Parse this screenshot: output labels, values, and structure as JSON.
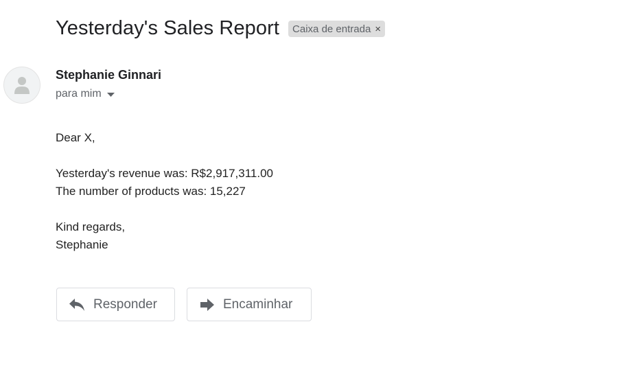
{
  "subject": "Yesterday's Sales Report",
  "label": {
    "text": "Caixa de entrada",
    "remove_glyph": "×"
  },
  "sender": {
    "name": "Stephanie Ginnari",
    "avatar_icon": "person-icon"
  },
  "recipient": {
    "text": "para mim",
    "caret_icon": "caret-down-icon"
  },
  "body": {
    "greeting": "Dear X,",
    "revenue_line": "Yesterday's revenue was: R$2,917,311.00",
    "products_line": "The number of products was: 15,227",
    "closing": "Kind regards,",
    "signature": "Stephanie"
  },
  "actions": {
    "reply": {
      "label": "Responder",
      "icon": "reply-arrow-icon"
    },
    "forward": {
      "label": "Encaminhar",
      "icon": "forward-arrow-icon"
    }
  },
  "colors": {
    "text_primary": "#202124",
    "text_secondary": "#5f6368",
    "chip_bg": "#dddddd",
    "button_border": "#dadce0"
  }
}
